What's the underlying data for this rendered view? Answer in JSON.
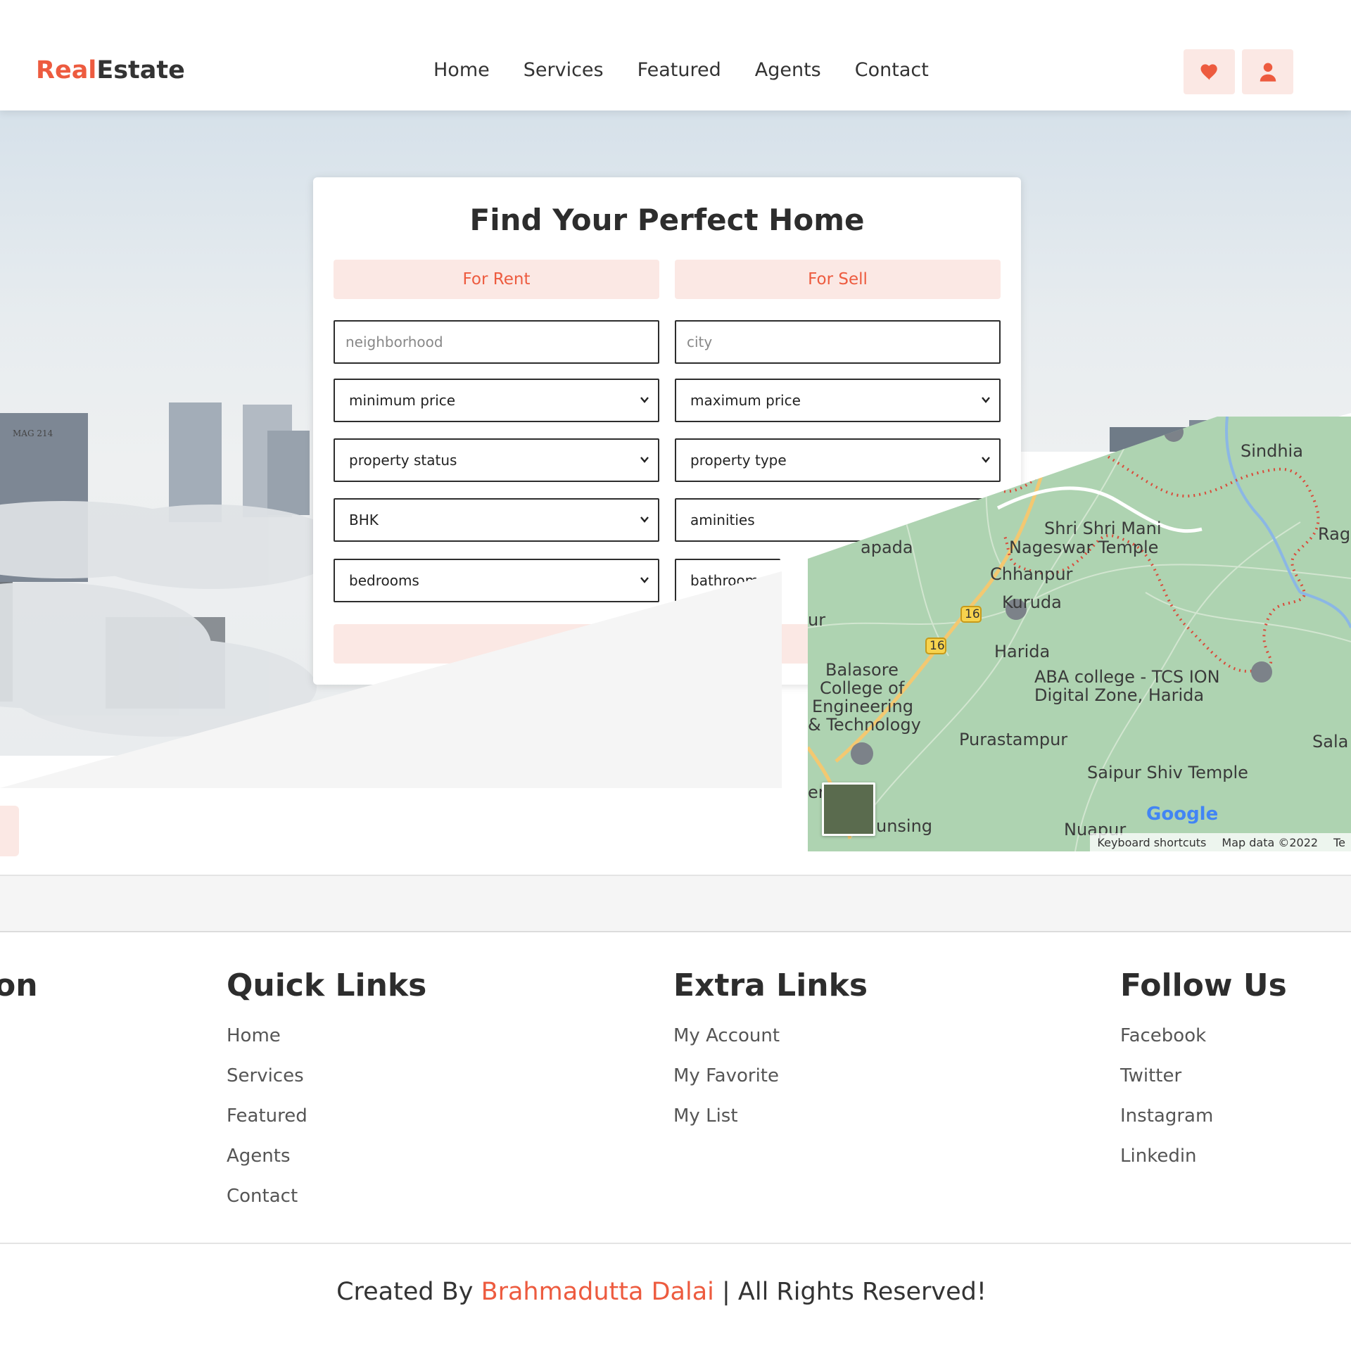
{
  "brand": {
    "name_accent": "Real",
    "name_rest": "Estate"
  },
  "nav": {
    "items": [
      "Home",
      "Services",
      "Featured",
      "Agents",
      "Contact"
    ]
  },
  "header_icons": [
    "heart-icon",
    "user-icon"
  ],
  "colors": {
    "accent": "#ed5b3f",
    "accent_light": "#fbe8e4",
    "text_dark": "#2d2d2d"
  },
  "search": {
    "title": "Find Your Perfect Home",
    "tabs": {
      "rent": "For Rent",
      "sell": "For Sell"
    },
    "neighborhood_placeholder": "neighborhood",
    "city_placeholder": "city",
    "min_price": "minimum price",
    "max_price": "maximum price",
    "status": "property status",
    "type": "property type",
    "bhk": "BHK",
    "amenities": "aminities",
    "bedrooms": "bedrooms",
    "bathrooms": "bathroom"
  },
  "map": {
    "labels": {
      "sindhia": "Sindhia",
      "rag": "Rag",
      "temple1_line1": "Shri Shri Mani",
      "temple1_line2": "Nageswar Temple",
      "apada": "apada",
      "chhanpur": "Chhanpur",
      "kuruda": "Kuruda",
      "ur": "ur",
      "harida": "Harida",
      "college_line1": "Balasore",
      "college_line2": "College of",
      "college_line3": "Engineering",
      "college_line4": "& Technology",
      "aba_line1": "ABA college - TCS ION",
      "aba_line2": "Digital Zone, Harida",
      "purastampur": "Purastampur",
      "sala": "Sala",
      "saipur": "Saipur Shiv Temple",
      "er": "er",
      "unsing": "unsing",
      "nuapur": "Nuapur",
      "road16": "16"
    },
    "google": "Google",
    "attribution": {
      "keyboard": "Keyboard shortcuts",
      "data": "Map data ©2022",
      "terms": "Te"
    }
  },
  "footer": {
    "partial_heading": "on",
    "quick_links": {
      "title": "Quick Links",
      "items": [
        "Home",
        "Services",
        "Featured",
        "Agents",
        "Contact"
      ]
    },
    "extra_links": {
      "title": "Extra Links",
      "items": [
        "My Account",
        "My Favorite",
        "My List"
      ]
    },
    "follow_us": {
      "title": "Follow Us",
      "items": [
        "Facebook",
        "Twitter",
        "Instagram",
        "Linkedin"
      ]
    },
    "credit": {
      "prefix": "Created By ",
      "name": "Brahmadutta Dalai",
      "suffix": " | All Rights Reserved!"
    }
  }
}
